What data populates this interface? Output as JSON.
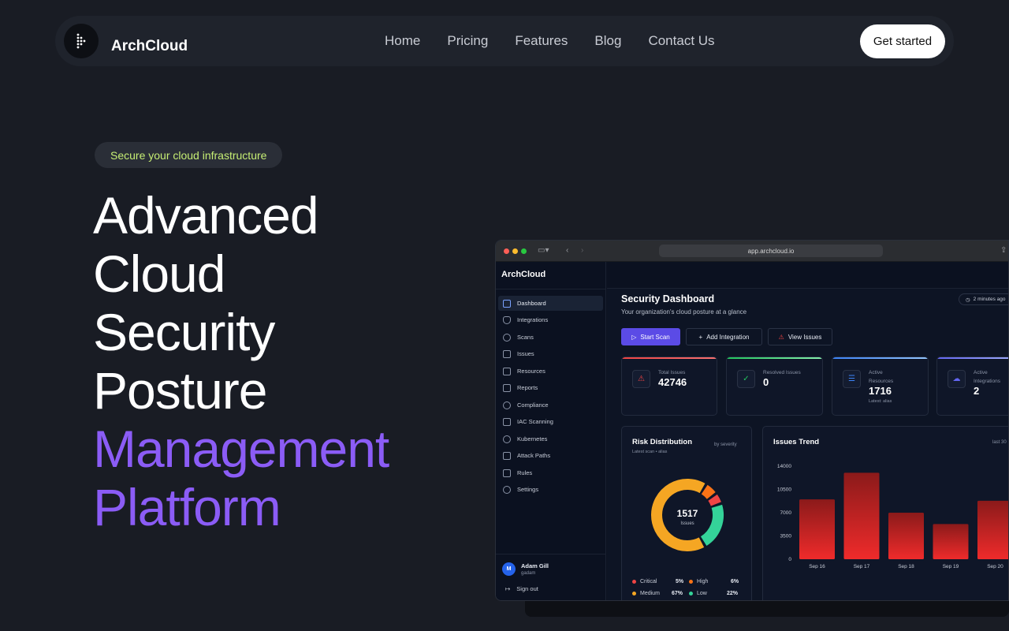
{
  "nav": {
    "brand": "ArchCloud",
    "links": [
      "Home",
      "Pricing",
      "Features",
      "Blog",
      "Contact Us"
    ],
    "cta": "Get started"
  },
  "hero": {
    "pill": "Secure your cloud infrastructure",
    "lines": [
      "Advanced",
      "Cloud",
      "Security",
      "Posture"
    ],
    "accent_lines": [
      "Management",
      "Platform"
    ],
    "accent_color": "#8b5cf6"
  },
  "mock": {
    "url": "app.archcloud.io",
    "sidebar": {
      "brand": "ArchCloud",
      "items": [
        "Dashboard",
        "Integrations",
        "Scans",
        "Issues",
        "Resources",
        "Reports",
        "Compliance",
        "IAC Scanning",
        "Kubernetes",
        "Attack Paths",
        "Rules",
        "Settings"
      ],
      "active": "Dashboard",
      "user": {
        "initial": "M",
        "name": "Adam Gill",
        "handle": "gadam"
      },
      "signout": "Sign out"
    },
    "header": {
      "title": "Security Dashboard",
      "subtitle": "Your organization's cloud posture at a glance",
      "updated": "2 minutes ago"
    },
    "actions": {
      "start_scan": "Start Scan",
      "add_integration": "Add Integration",
      "view_issues": "View Issues"
    },
    "stats": [
      {
        "label": "Total Issues",
        "value": "42746",
        "color": "#ef4444"
      },
      {
        "label": "Resolved Issues",
        "value": "0",
        "color": "#22c55e"
      },
      {
        "label_1": "Active",
        "label_2": "Resources",
        "value": "1716",
        "note": "Latest: alias",
        "color": "#3b82f6"
      },
      {
        "label_1": "Active",
        "label_2": "Integrations",
        "value": "2",
        "color": "#6366f1"
      }
    ],
    "risk": {
      "title": "Risk Distribution",
      "subtitle": "Latest scan • alias",
      "tag": "by severity",
      "center_value": "1517",
      "center_label": "Issues",
      "legend": [
        {
          "name": "Critical",
          "pct": "5%",
          "color": "#ef4444"
        },
        {
          "name": "High",
          "pct": "6%",
          "color": "#f97316"
        },
        {
          "name": "Medium",
          "pct": "67%",
          "color": "#f5a623"
        },
        {
          "name": "Low",
          "pct": "22%",
          "color": "#34d399"
        }
      ]
    },
    "trend": {
      "title": "Issues Trend",
      "tag": "last 30"
    }
  },
  "chart_data": {
    "type": "bar",
    "title": "Issues Trend",
    "categories": [
      "Sep 16",
      "Sep 17",
      "Sep 18",
      "Sep 19",
      "Sep 20"
    ],
    "values": [
      9000,
      13000,
      7000,
      5300,
      8800
    ],
    "ylim": [
      0,
      14000
    ],
    "yticks": [
      0,
      3500,
      7000,
      10500,
      14000
    ],
    "xlabel": "",
    "ylabel": ""
  }
}
